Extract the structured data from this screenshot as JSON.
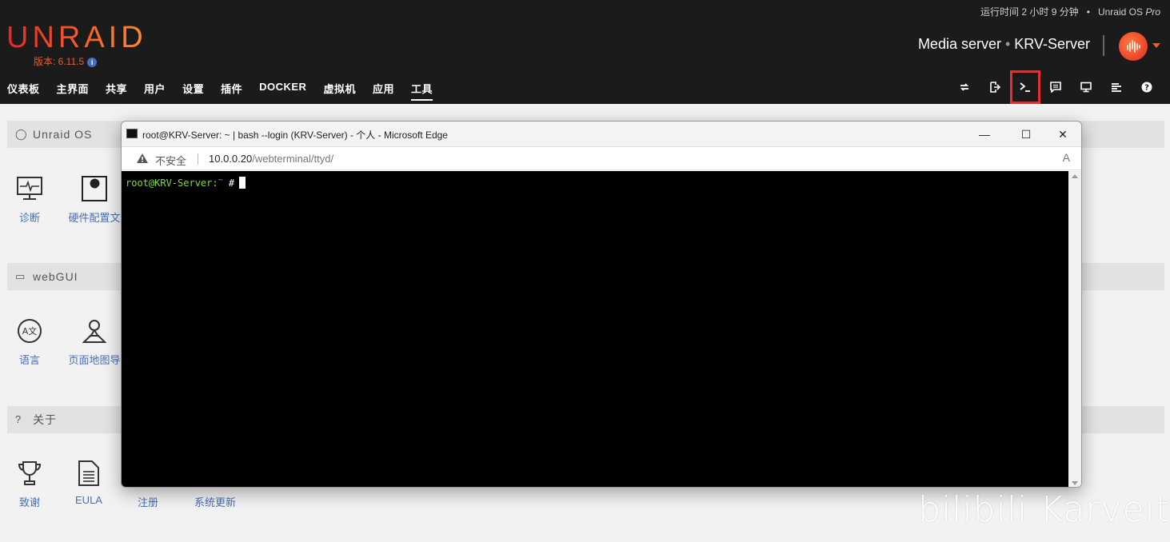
{
  "header": {
    "uptime": "运行时间 2 小时 9 分钟",
    "dot": "•",
    "edition_prefix": "Unraid OS",
    "edition_suffix": "Pro",
    "logo": "UNRAID",
    "version": "版本: 6.11.5",
    "info_icon": "i",
    "server_desc": "Media server",
    "server_name": "KRV-Server"
  },
  "nav": {
    "items": [
      "仪表板",
      "主界面",
      "共享",
      "用户",
      "设置",
      "插件",
      "DOCKER",
      "虚拟机",
      "应用",
      "工具"
    ],
    "active_index": 9
  },
  "toolbar": {
    "icons": [
      "reboot-icon",
      "logout-icon",
      "terminal-icon",
      "feedback-icon",
      "screen-icon",
      "log-icon",
      "help-icon"
    ],
    "highlighted": "terminal-icon",
    "highlight_color": "#e53030"
  },
  "sections": [
    {
      "title": "Unraid OS",
      "icon": "os-icon",
      "tiles": [
        "诊断",
        "硬件配置文"
      ]
    },
    {
      "title": "webGUI",
      "icon": "monitor-icon",
      "tiles": [
        "语言",
        "页面地图导"
      ]
    },
    {
      "title": "关于",
      "icon": "question-icon",
      "tiles": [
        "致谢",
        "EULA",
        "注册",
        "系统更新"
      ]
    }
  ],
  "edge": {
    "title": "root@KRV-Server: ~ | bash --login (KRV-Server) - 个人 - Microsoft Edge",
    "minimize": "—",
    "maximize": "☐",
    "close": "✕",
    "insecure_label": "不安全",
    "url_host": "10.0.0.20",
    "url_path": "/webterminal/ttyd/",
    "read_aloud": "A",
    "terminal": {
      "user_host": "root@KRV-Server:",
      "dir": "~",
      "symbol": "#"
    }
  },
  "watermark": "bilibili Karveit",
  "colors": {
    "accent": "#f15a2c",
    "link": "#486dba",
    "header_bg": "#1c1b1b"
  }
}
